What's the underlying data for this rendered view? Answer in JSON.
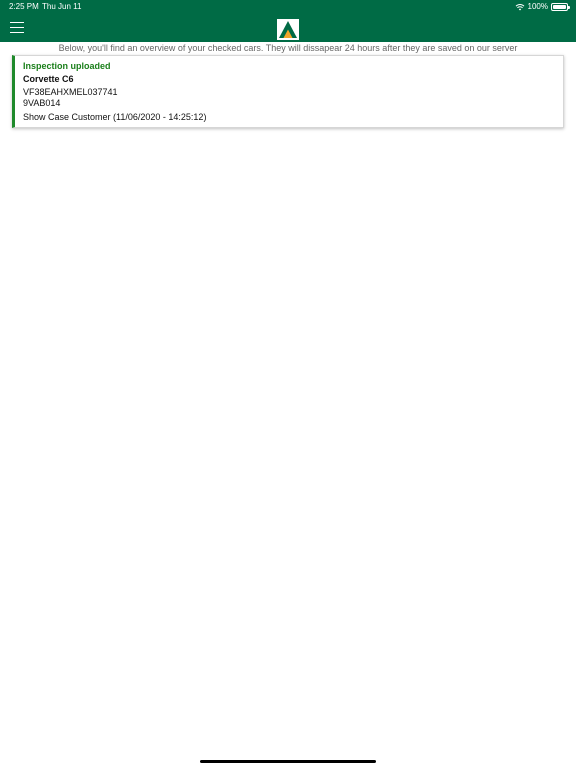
{
  "statusbar": {
    "time": "2:25 PM",
    "date": "Thu Jun 11",
    "battery": "100%",
    "battery_level": 1.0,
    "icons": [
      "wifi-icon",
      "battery-icon"
    ]
  },
  "header": {
    "menu_icon": "hamburger-menu-icon",
    "logo_icon": "triangle-logo-icon",
    "brand_color": "#006b45",
    "logo_accent": "#f2a52b"
  },
  "intro_text": "Below, you'll find an overview of your checked cars. They will dissapear 24 hours after they are saved on our server",
  "inspections": [
    {
      "status": "Inspection uploaded",
      "status_color": "#1a7f1a",
      "model": "Corvette C6",
      "vin": "VF38EAHXMEL037741",
      "plate": "9VAB014",
      "customer": "Show Case Customer (11/06/2020 - 14:25:12)"
    }
  ]
}
